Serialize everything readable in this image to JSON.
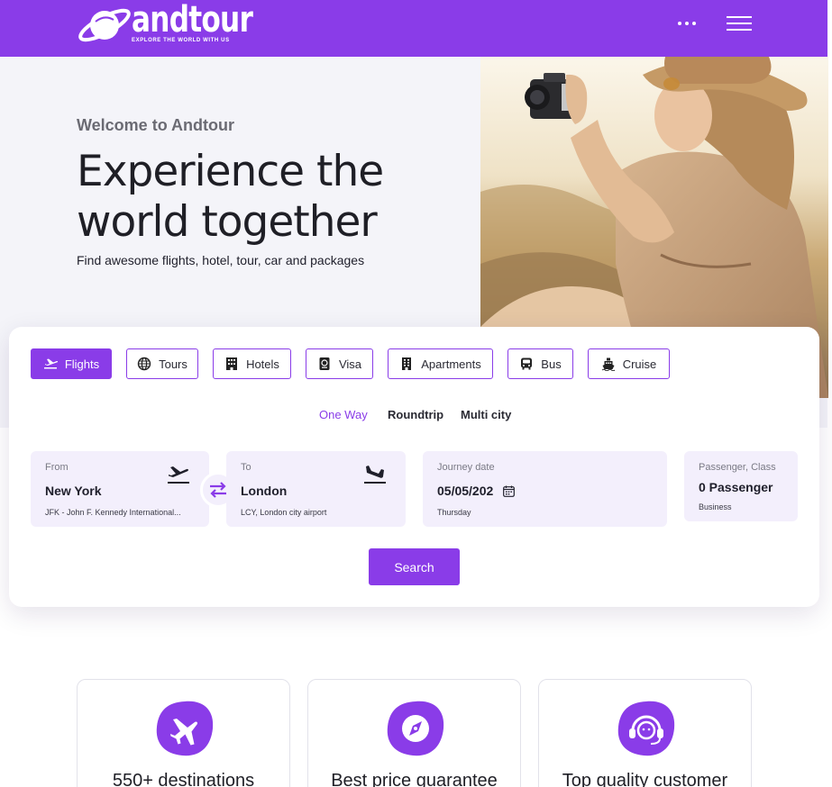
{
  "brand": {
    "name": "andtour",
    "tagline": "EXPLORE THE WORLD WITH US",
    "accent": "#8a3ce8"
  },
  "header": {
    "more_icon": "ellipsis-icon",
    "menu_icon": "hamburger-icon"
  },
  "hero": {
    "welcome": "Welcome to Andtour",
    "headline": "Experience the world together",
    "subline": "Find awesome flights, hotel, tour, car and packages"
  },
  "search": {
    "tabs": [
      {
        "label": "Flights",
        "icon": "plane-icon",
        "active": true
      },
      {
        "label": "Tours",
        "icon": "globe-icon"
      },
      {
        "label": "Hotels",
        "icon": "hotel-icon"
      },
      {
        "label": "Visa",
        "icon": "passport-icon"
      },
      {
        "label": "Apartments",
        "icon": "apartment-icon"
      },
      {
        "label": "Bus",
        "icon": "bus-icon"
      },
      {
        "label": "Cruise",
        "icon": "ship-icon"
      }
    ],
    "trip_types": [
      {
        "label": "One Way",
        "active": true
      },
      {
        "label": "Roundtrip"
      },
      {
        "label": "Multi city"
      }
    ],
    "from": {
      "label": "From",
      "value": "New York",
      "sub": "JFK - John F. Kennedy International..."
    },
    "to": {
      "label": "To",
      "value": "London",
      "sub": "LCY, London city airport"
    },
    "date": {
      "label": "Journey date",
      "value": "05/05/202",
      "sub": "Thursday"
    },
    "passenger": {
      "label": "Passenger, Class",
      "value": "0 Passenger",
      "sub": "Business"
    },
    "search_label": "Search"
  },
  "features": [
    {
      "title": "550+ destinations",
      "icon": "plane-icon"
    },
    {
      "title": "Best price guarantee",
      "icon": "compass-icon"
    },
    {
      "title": "Top quality customer",
      "icon": "headset-icon"
    }
  ]
}
